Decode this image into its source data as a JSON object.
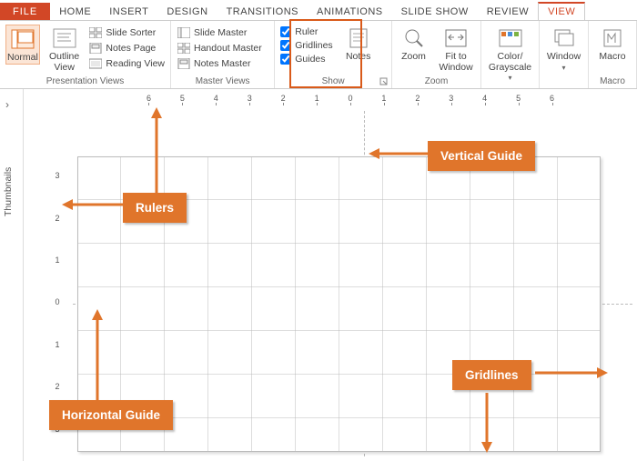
{
  "tabs": {
    "file": "FILE",
    "home": "HOME",
    "insert": "INSERT",
    "design": "DESIGN",
    "transitions": "TRANSITIONS",
    "animations": "ANIMATIONS",
    "slideshow": "SLIDE SHOW",
    "review": "REVIEW",
    "view": "VIEW"
  },
  "ribbon": {
    "presentation_views": {
      "label": "Presentation Views",
      "normal": "Normal",
      "outline": "Outline View",
      "slide_sorter": "Slide Sorter",
      "notes_page": "Notes Page",
      "reading_view": "Reading View"
    },
    "master_views": {
      "label": "Master Views",
      "slide_master": "Slide Master",
      "handout_master": "Handout Master",
      "notes_master": "Notes Master"
    },
    "show": {
      "label": "Show",
      "ruler": "Ruler",
      "gridlines": "Gridlines",
      "guides": "Guides",
      "notes": "Notes"
    },
    "zoom": {
      "label": "Zoom",
      "zoom": "Zoom",
      "fit": "Fit to Window"
    },
    "color": {
      "label": "Color/ Grayscale"
    },
    "window": "Window",
    "macros": "Macro"
  },
  "thumbnails": {
    "label": "Thumbnails",
    "toggle": "›"
  },
  "hruler_ticks": [
    "6",
    "5",
    "4",
    "3",
    "2",
    "1",
    "0",
    "1",
    "2",
    "3",
    "4",
    "5",
    "6"
  ],
  "vruler_ticks": [
    "3",
    "2",
    "1",
    "0",
    "1",
    "2",
    "3"
  ],
  "callouts": {
    "rulers": "Rulers",
    "vertical_guide": "Vertical Guide",
    "horizontal_guide": "Horizontal Guide",
    "gridlines": "Gridlines"
  }
}
